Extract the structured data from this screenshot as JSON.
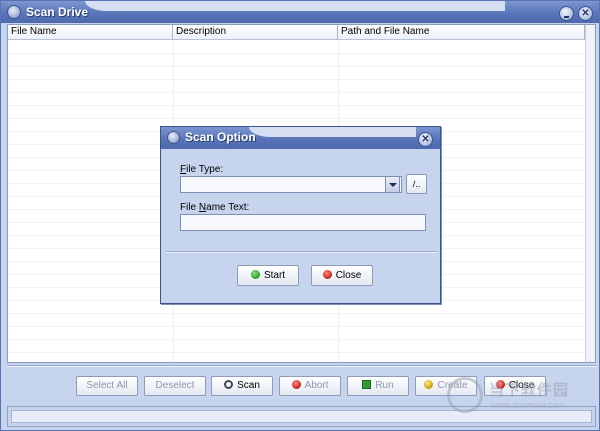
{
  "window": {
    "title": "Scan Drive"
  },
  "list": {
    "columns": [
      "File Name",
      "Description",
      "Path and File Name"
    ]
  },
  "toolbar": {
    "select_all": "Select All",
    "deselect": "Deselect",
    "scan": "Scan",
    "abort": "Abort",
    "run": "Run",
    "create": "Create",
    "close": "Close"
  },
  "dialog": {
    "title": "Scan Option",
    "file_type_label_prefix": "F",
    "file_type_label_rest": "ile Type:",
    "file_type_value": "",
    "browse_label": "/..",
    "file_name_label_prefix": "File ",
    "file_name_label_underline": "N",
    "file_name_label_rest": "ame Text:",
    "file_name_value": "",
    "start_label": "Start",
    "close_label": "Close"
  },
  "watermark": {
    "text": "当下软件园",
    "sub": "www.downxia.com"
  },
  "colors": {
    "titlebar": "#5a76ba",
    "panel": "#c7d4ee",
    "accent_border": "#3d548f"
  },
  "icons": {
    "start": "green-check-icon",
    "close": "red-x-icon",
    "scan": "magnifier-icon",
    "abort": "red-stop-icon",
    "run": "green-run-icon",
    "create": "yellow-create-icon"
  }
}
